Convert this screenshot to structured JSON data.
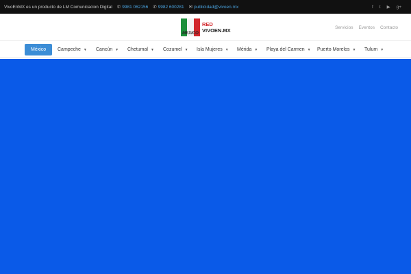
{
  "topbar": {
    "tagline": "VivoEnMX es un producto de LM Comunicacion Digital",
    "phone1": "9981 062156",
    "phone2": "9982 600281",
    "email": "publicidad@vivoen.mx",
    "social_icons": [
      "facebook-icon",
      "twitter-icon",
      "youtube-icon",
      "google-plus-icon"
    ]
  },
  "logo": {
    "flag_text": "MEXICO",
    "line1": "RED",
    "line2": "VIVOEN.MX"
  },
  "header_links": [
    "Servicios",
    "Eventos",
    "Contacto"
  ],
  "nav": {
    "items": [
      {
        "label": "México",
        "active": true,
        "dropdown": false
      },
      {
        "label": "Campeche",
        "dropdown": true
      },
      {
        "label": "Cancún",
        "dropdown": true
      },
      {
        "label": "Chetumal",
        "dropdown": true
      },
      {
        "label": "Cozumel",
        "dropdown": true
      },
      {
        "label": "Isla Mujeres",
        "dropdown": true
      },
      {
        "label": "Mérida",
        "dropdown": true
      },
      {
        "label": "Playa del Carmen",
        "dropdown": true
      },
      {
        "label": "Puerto Morelos",
        "dropdown": true
      },
      {
        "label": "Tulum",
        "dropdown": true
      }
    ]
  },
  "colors": {
    "topbar_bg": "#111111",
    "accent": "#3c8dd6",
    "hero_bg": "#0a5ae8"
  }
}
